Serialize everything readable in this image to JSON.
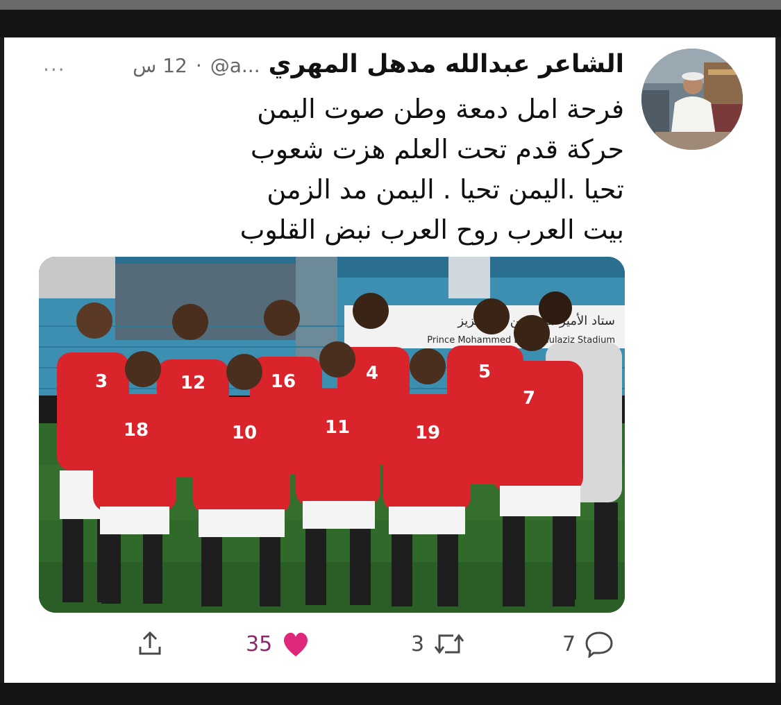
{
  "tweet": {
    "author_name": "الشاعر عبدالله مدهل المهري",
    "handle": "@a...",
    "separator": "·",
    "time": "12 س",
    "more_label": "...",
    "lines": [
      "فرحة امل دمعة وطن صوت اليمن",
      "حركة  قدم تحت العلم  هزت شعوب",
      "تحيا .اليمن تحيا . اليمن مد الزمن",
      "بيت العرب روح العرب نبض القلوب"
    ],
    "photo": {
      "banner_arabic": "ستاد الأمير محمد بن عبدالعزيز",
      "banner_english": "Prince Mohammed Bin Abdulaziz Stadium",
      "jersey_numbers_back": [
        "3",
        "12",
        "16",
        "4",
        "5",
        "7"
      ],
      "jersey_numbers_front": [
        "18",
        "10",
        "11",
        "19"
      ]
    },
    "actions": {
      "likes": "35",
      "retweets": "3",
      "replies": "7"
    }
  },
  "colors": {
    "like": "#e0287a",
    "jersey": "#d9242b",
    "pitch": "#2f6a2a",
    "stands": "#3c8fb0"
  }
}
